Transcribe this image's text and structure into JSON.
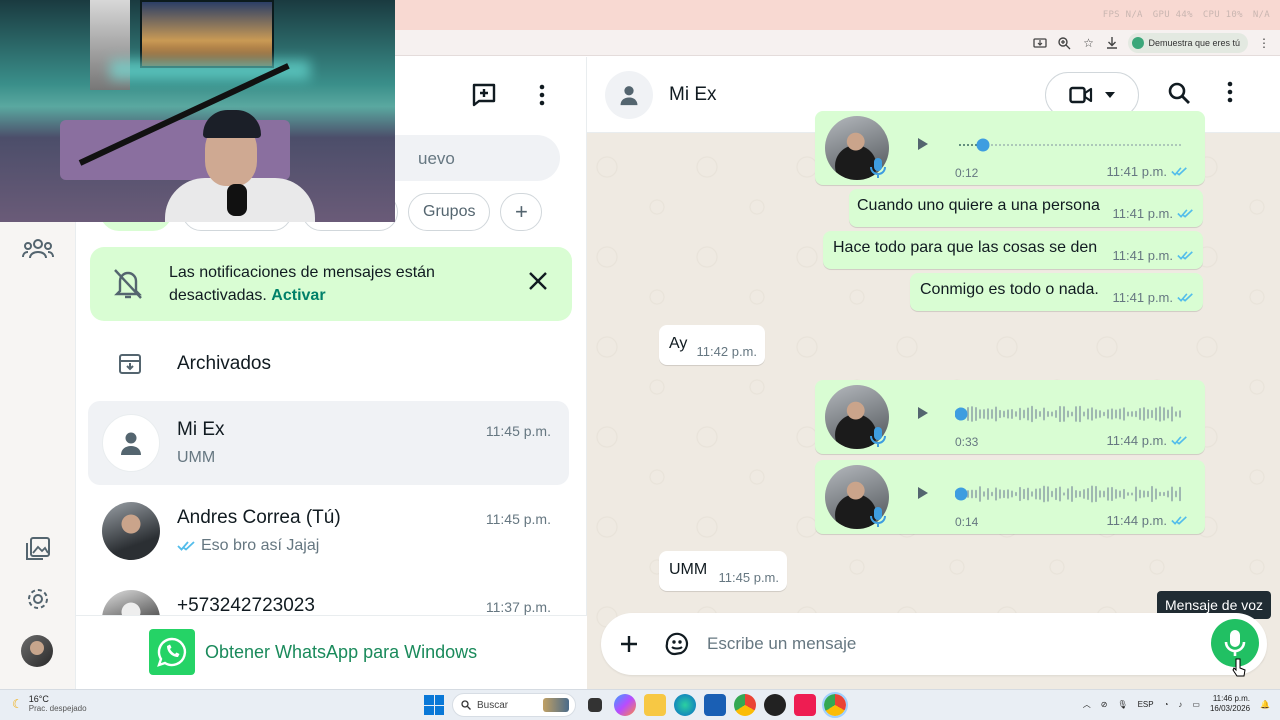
{
  "browser": {
    "perf": [
      "FPS N/A",
      "GPU 44%",
      "CPU 10%",
      "N/A"
    ],
    "captcha_label": "Demuestra que eres tú"
  },
  "chatlist": {
    "search_placeholder": "uevo",
    "filters": [
      "Grupos",
      "+"
    ],
    "notice": {
      "text": "Las notificaciones de mensajes están desactivadas.",
      "link": "Activar"
    },
    "archived_label": "Archivados",
    "chats": [
      {
        "name": "Mi Ex",
        "time": "11:45 p.m.",
        "preview": "UMM",
        "ticks": false
      },
      {
        "name": "Andres Correa (Tú)",
        "time": "11:45 p.m.",
        "preview": "Eso bro así Jajaj",
        "ticks": true
      },
      {
        "name": "+573242723023",
        "time": "11:37 p.m.",
        "preview": "",
        "ticks": false
      }
    ],
    "windows_banner": "Obtener WhatsApp para Windows"
  },
  "conversation": {
    "contact_name": "Mi Ex",
    "messages": [
      {
        "type": "voice",
        "dir": "out",
        "duration": "0:12",
        "time": "11:41 p.m.",
        "progress": 0.1
      },
      {
        "type": "text",
        "dir": "out",
        "text": "Cuando uno quiere a una persona",
        "time": "11:41 p.m."
      },
      {
        "type": "text",
        "dir": "out",
        "text": "Hace todo para que las cosas se den",
        "time": "11:41 p.m."
      },
      {
        "type": "text",
        "dir": "out",
        "text": "Conmigo es todo o nada.",
        "time": "11:41 p.m."
      },
      {
        "type": "text",
        "dir": "in",
        "text": "Ay",
        "time": "11:42 p.m."
      },
      {
        "type": "voice",
        "dir": "out",
        "duration": "0:33",
        "time": "11:44 p.m.",
        "progress": 0
      },
      {
        "type": "voice",
        "dir": "out",
        "duration": "0:14",
        "time": "11:44 p.m.",
        "progress": 0
      },
      {
        "type": "text",
        "dir": "in",
        "text": "UMM",
        "time": "11:45 p.m."
      }
    ],
    "composer_placeholder": "Escribe un mensaje",
    "voice_tooltip": "Mensaje de voz"
  },
  "taskbar": {
    "temp": "16°C",
    "weather": "Prac. despejado",
    "search_label": "Buscar",
    "lang": "ESP",
    "time": "11:46 p.m.",
    "date": "16/03/2026"
  },
  "colors": {
    "accent": "#21c063",
    "bubble_out": "#d9fdd3",
    "link": "#008069",
    "ticks": "#53bdeb"
  }
}
